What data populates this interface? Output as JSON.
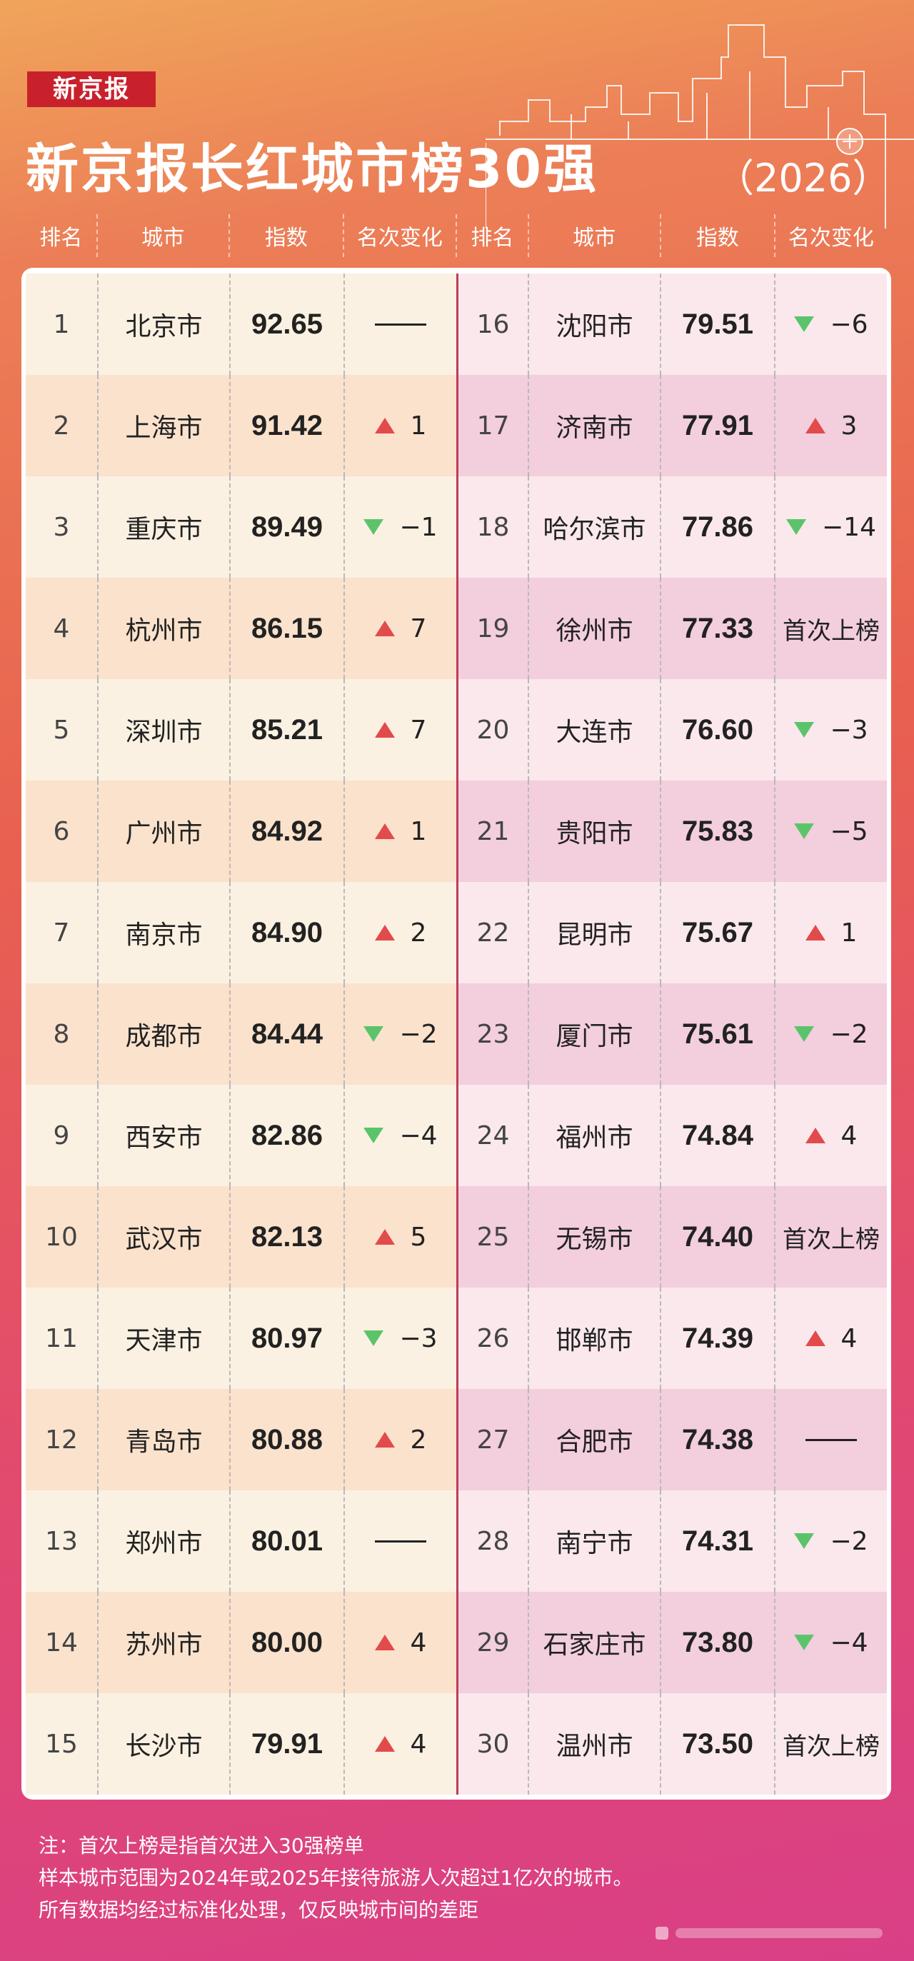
{
  "brand": "新京报",
  "title": "新京报长红城市榜30强",
  "year": "（2026）",
  "headers": [
    "排名",
    "城市",
    "指数",
    "名次变化",
    "排名",
    "城市",
    "指数",
    "名次变化"
  ],
  "colors": {
    "up": "#e24b4b",
    "down": "#5bc46b",
    "brand": "#c8212c"
  },
  "left_rows": [
    {
      "rank": "1",
      "city": "北京市",
      "index": "92.65",
      "change_type": "same",
      "change": ""
    },
    {
      "rank": "2",
      "city": "上海市",
      "index": "91.42",
      "change_type": "up",
      "change": "1"
    },
    {
      "rank": "3",
      "city": "重庆市",
      "index": "89.49",
      "change_type": "down",
      "change": "−1"
    },
    {
      "rank": "4",
      "city": "杭州市",
      "index": "86.15",
      "change_type": "up",
      "change": "7"
    },
    {
      "rank": "5",
      "city": "深圳市",
      "index": "85.21",
      "change_type": "up",
      "change": "7"
    },
    {
      "rank": "6",
      "city": "广州市",
      "index": "84.92",
      "change_type": "up",
      "change": "1"
    },
    {
      "rank": "7",
      "city": "南京市",
      "index": "84.90",
      "change_type": "up",
      "change": "2"
    },
    {
      "rank": "8",
      "city": "成都市",
      "index": "84.44",
      "change_type": "down",
      "change": "−2"
    },
    {
      "rank": "9",
      "city": "西安市",
      "index": "82.86",
      "change_type": "down",
      "change": "−4"
    },
    {
      "rank": "10",
      "city": "武汉市",
      "index": "82.13",
      "change_type": "up",
      "change": "5"
    },
    {
      "rank": "11",
      "city": "天津市",
      "index": "80.97",
      "change_type": "down",
      "change": "−3"
    },
    {
      "rank": "12",
      "city": "青岛市",
      "index": "80.88",
      "change_type": "up",
      "change": "2"
    },
    {
      "rank": "13",
      "city": "郑州市",
      "index": "80.01",
      "change_type": "same",
      "change": ""
    },
    {
      "rank": "14",
      "city": "苏州市",
      "index": "80.00",
      "change_type": "up",
      "change": "4"
    },
    {
      "rank": "15",
      "city": "长沙市",
      "index": "79.91",
      "change_type": "up",
      "change": "4"
    }
  ],
  "right_rows": [
    {
      "rank": "16",
      "city": "沈阳市",
      "index": "79.51",
      "change_type": "down",
      "change": "−6"
    },
    {
      "rank": "17",
      "city": "济南市",
      "index": "77.91",
      "change_type": "up",
      "change": "3"
    },
    {
      "rank": "18",
      "city": "哈尔滨市",
      "index": "77.86",
      "change_type": "down",
      "change": "−14"
    },
    {
      "rank": "19",
      "city": "徐州市",
      "index": "77.33",
      "change_type": "new",
      "change": "首次上榜"
    },
    {
      "rank": "20",
      "city": "大连市",
      "index": "76.60",
      "change_type": "down",
      "change": "−3"
    },
    {
      "rank": "21",
      "city": "贵阳市",
      "index": "75.83",
      "change_type": "down",
      "change": "−5"
    },
    {
      "rank": "22",
      "city": "昆明市",
      "index": "75.67",
      "change_type": "up",
      "change": "1"
    },
    {
      "rank": "23",
      "city": "厦门市",
      "index": "75.61",
      "change_type": "down",
      "change": "−2"
    },
    {
      "rank": "24",
      "city": "福州市",
      "index": "74.84",
      "change_type": "up",
      "change": "4"
    },
    {
      "rank": "25",
      "city": "无锡市",
      "index": "74.40",
      "change_type": "new",
      "change": "首次上榜"
    },
    {
      "rank": "26",
      "city": "邯郸市",
      "index": "74.39",
      "change_type": "up",
      "change": "4"
    },
    {
      "rank": "27",
      "city": "合肥市",
      "index": "74.38",
      "change_type": "same",
      "change": ""
    },
    {
      "rank": "28",
      "city": "南宁市",
      "index": "74.31",
      "change_type": "down",
      "change": "−2"
    },
    {
      "rank": "29",
      "city": "石家庄市",
      "index": "73.80",
      "change_type": "down",
      "change": "−4"
    },
    {
      "rank": "30",
      "city": "温州市",
      "index": "73.50",
      "change_type": "new",
      "change": "首次上榜"
    }
  ],
  "notes": [
    "注：首次上榜是指首次进入30强榜单",
    "样本城市范围为2024年或2025年接待旅游人次超过1亿次的城市。",
    "所有数据均经过标准化处理，仅反映城市间的差距"
  ]
}
